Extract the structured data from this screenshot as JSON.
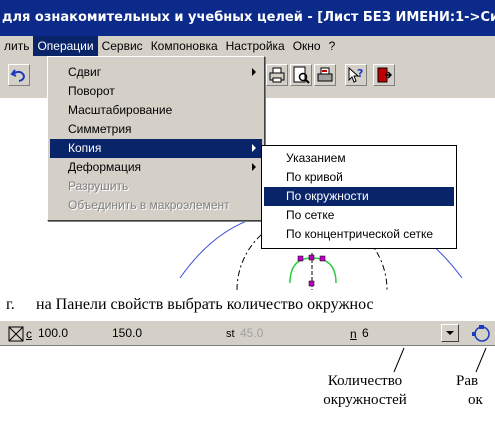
{
  "window": {
    "title": "для ознакомительных и учебных целей - [Лист БЕЗ ИМЕНИ:1->Си"
  },
  "menubar": {
    "items": [
      "лить",
      "Операции",
      "Сервис",
      "Компоновка",
      "Настройка",
      "Окно",
      "?"
    ],
    "active_index": 1
  },
  "dropdown": {
    "items": [
      {
        "label": "Сдвиг",
        "submenu": true,
        "disabled": false,
        "highlighted": false
      },
      {
        "label": "Поворот",
        "submenu": false,
        "disabled": false,
        "highlighted": false
      },
      {
        "label": "Масштабирование",
        "submenu": false,
        "disabled": false,
        "highlighted": false
      },
      {
        "label": "Симметрия",
        "submenu": false,
        "disabled": false,
        "highlighted": false
      },
      {
        "label": "Копия",
        "submenu": true,
        "disabled": false,
        "highlighted": true
      },
      {
        "label": "Деформация",
        "submenu": true,
        "disabled": false,
        "highlighted": false
      },
      {
        "label": "Разрушить",
        "submenu": false,
        "disabled": true,
        "highlighted": false
      },
      {
        "label": "Объединить в макроэлемент",
        "submenu": false,
        "disabled": true,
        "highlighted": false
      }
    ]
  },
  "submenu": {
    "items": [
      {
        "label": "Указанием",
        "highlighted": false
      },
      {
        "label": "По кривой",
        "highlighted": false
      },
      {
        "label": "По окружности",
        "highlighted": true
      },
      {
        "label": "По сетке",
        "highlighted": false
      },
      {
        "label": "По концентрической сетке",
        "highlighted": false
      }
    ]
  },
  "caption": {
    "marker": "г.",
    "text": "на Панели свойств выбрать количество окружнос"
  },
  "property_bar": {
    "c_label": "c",
    "c_x": "100.0",
    "c_y": "150.0",
    "st_label": "st",
    "st_value": "45.0",
    "n_label": "n",
    "n_value": "6"
  },
  "annotations": {
    "count_line1": "Количество",
    "count_line2": "окружностей",
    "right_line1": "Рав",
    "right_line2": "ок"
  },
  "colors": {
    "titlebar": "#0b2a8a",
    "highlight": "#0a246a",
    "face": "#d4d0c8",
    "arc_blue": "#3a4cd8",
    "arc_green": "#2ecc40",
    "marker_magenta": "#c000c0"
  }
}
